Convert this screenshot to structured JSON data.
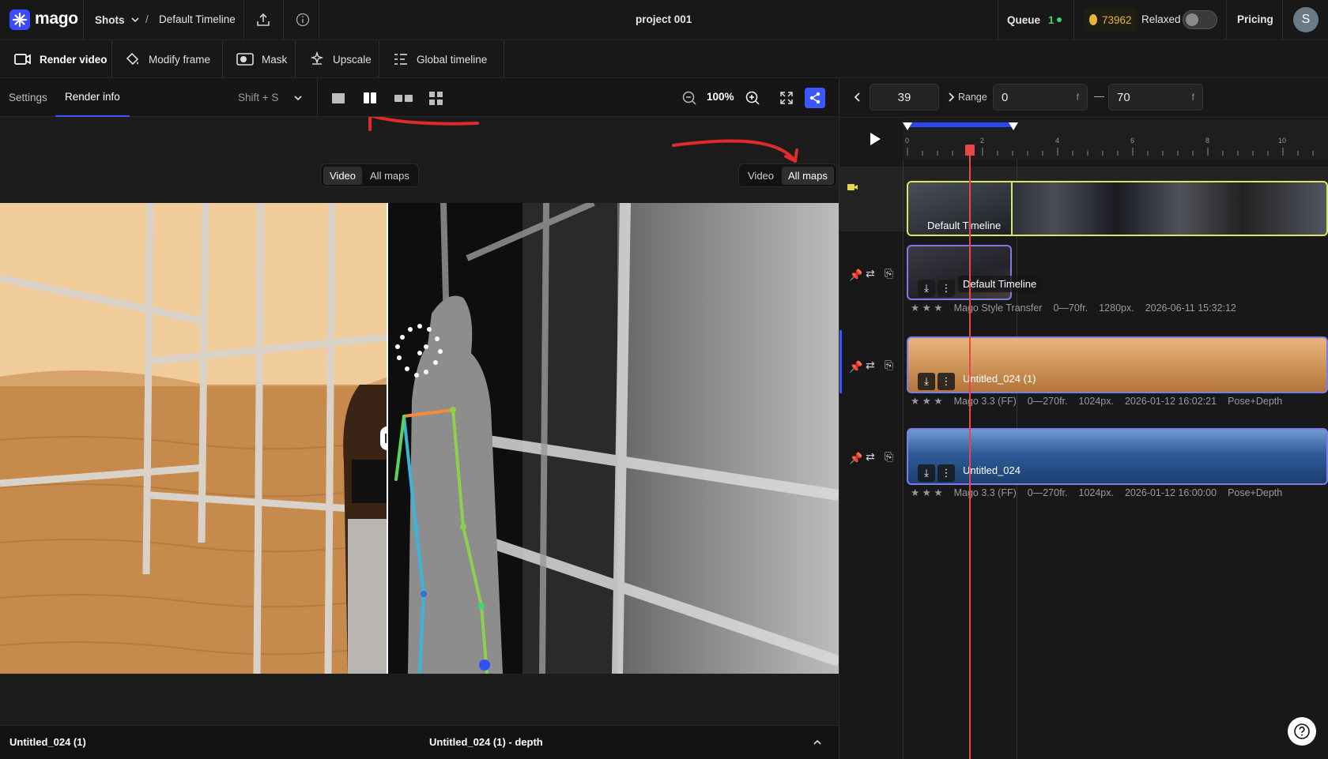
{
  "app": {
    "logo_text": "mago"
  },
  "topbar": {
    "shots_label": "Shots",
    "breadcrumb_sep": "/",
    "breadcrumb_current": "Default Timeline",
    "project_title": "project 001",
    "queue_label": "Queue",
    "queue_count": "1",
    "credits": "73962",
    "mode_label": "Relaxed",
    "pricing_label": "Pricing",
    "avatar_initial": "S"
  },
  "toolbar": {
    "render_video": "Render video",
    "modify_frame": "Modify frame",
    "mask": "Mask",
    "upscale": "Upscale",
    "global_timeline": "Global timeline"
  },
  "subbar": {
    "tab_settings": "Settings",
    "tab_render_info": "Render info",
    "shortcut": "Shift + S",
    "zoom_level": "100%"
  },
  "viewer": {
    "left_toggle": {
      "video": "Video",
      "all_maps": "All maps",
      "selected": "Video"
    },
    "right_toggle": {
      "video": "Video",
      "all_maps": "All maps",
      "selected": "All maps"
    }
  },
  "footer": {
    "left_name": "Untitled_024 (1)",
    "center_name": "Untitled_024 (1) - depth"
  },
  "timeline": {
    "current_frame": "39",
    "range_label": "Range",
    "range_start": "0",
    "range_end": "70",
    "frame_unit": "f",
    "range_dash": "—",
    "ruler_ticks": [
      "0",
      "2",
      "4",
      "6",
      "8",
      "10"
    ],
    "default_track_label": "Default Timeline",
    "tracks": [
      {
        "name": "Default Timeline",
        "rating": "★ ★ ★",
        "model": "Mago Style Transfer",
        "frames": "0—70fr.",
        "resolution": "1280px.",
        "date": "2026-06-11 15:32:12",
        "maps": ""
      },
      {
        "name": "Untitled_024 (1)",
        "rating": "★ ★ ★",
        "model": "Mago 3.3 (FF)",
        "frames": "0—270fr.",
        "resolution": "1024px.",
        "date": "2026-01-12 16:02:21",
        "maps": "Pose+Depth"
      },
      {
        "name": "Untitled_024",
        "rating": "★ ★ ★",
        "model": "Mago 3.3 (FF)",
        "frames": "0—270fr.",
        "resolution": "1024px.",
        "date": "2026-01-12 16:00:00",
        "maps": "Pose+Depth"
      }
    ]
  },
  "colors": {
    "accent": "#3d57ff",
    "playhead": "#e94747",
    "selected_clip_border": "#d7e85a",
    "queue_dot": "#3fd46a",
    "coin": "#e7b43a"
  }
}
